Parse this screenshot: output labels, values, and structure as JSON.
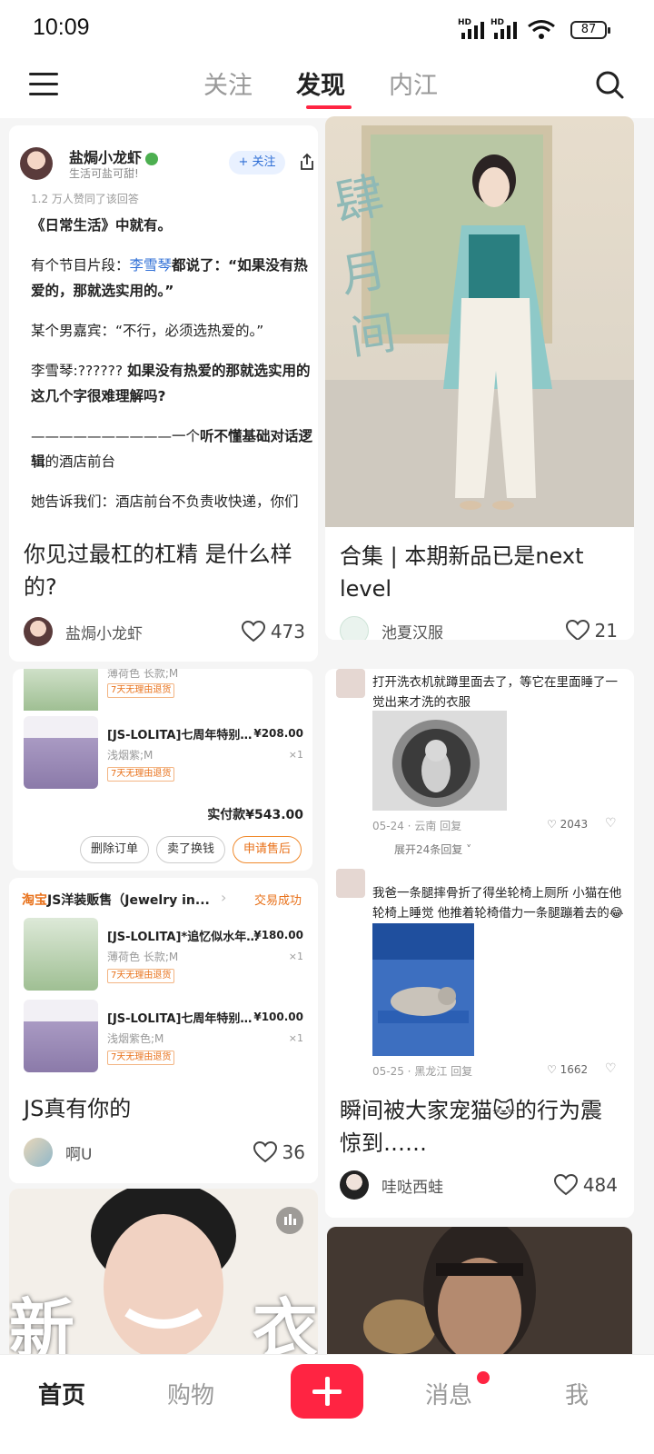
{
  "status_bar": {
    "time": "10:09",
    "hd1": "HD",
    "hd2": "HD",
    "battery": "87"
  },
  "top_nav": {
    "tabs": [
      "关注",
      "发现",
      "内江"
    ],
    "active_tab": "发现"
  },
  "feed": {
    "card1": {
      "answerer": "盐焗小龙虾",
      "tagline": "生活可盐可甜!",
      "follow_label": "+ 关注",
      "agree_count": "1.2 万人赞同了该回答",
      "body": {
        "p1": "《日常生活》中就有。",
        "p2_a": "有个节目片段：",
        "p2_link": "李雪琴",
        "p2_b": "都说了：“如果没有热爱的，那就选实用的。”",
        "p3": "某个男嘉宾：“不行，必须选热爱的。”",
        "p4_a": "李雪琴:?????? ",
        "p4_b": "如果没有热爱的那就选实用的这几个字很难理解吗?",
        "p5_a": "——————————一个",
        "p5_b": "听不懂基础对话逻辑",
        "p5_c": "的酒店前台",
        "p6": "她告诉我们：酒店前台不负责收快递，你们"
      },
      "title": "你见过最杠的杠精 是什么样的?",
      "author": "盐焗小龙虾",
      "likes": "473"
    },
    "card2": {
      "title": "合集 | 本期新品已是next level",
      "author": "池夏汉服",
      "likes": "21"
    },
    "card3": {
      "item_top": {
        "name": "薄荷色 长款;M",
        "tag": "7天无理由退货"
      },
      "item1": {
        "name": "[JS-LOLITA]七周年特别款 ...",
        "price": "¥208.00",
        "spec": "浅烟紫;M",
        "qty": "×1",
        "tag": "7天无理由退货"
      },
      "total": "实付款¥543.00",
      "buttons": [
        "删除订单",
        "卖了换钱",
        "申请售后"
      ]
    },
    "card4": {
      "shop_prefix": "淘宝",
      "shop": "JS洋装贩售（Jewelry in...",
      "status": "交易成功",
      "items": [
        {
          "name": "[JS-LOLITA]*追忆似水年华*...",
          "price": "¥180.00",
          "spec": "薄荷色 长款;M",
          "qty": "×1",
          "tag": "7天无理由退货"
        },
        {
          "name": "[JS-LOLITA]七周年特别款 ...",
          "price": "¥100.00",
          "spec": "浅烟紫色;M",
          "qty": "×1",
          "tag": "7天无理由退货"
        }
      ],
      "title": "JS真有你的",
      "author": "啊U",
      "likes": "36"
    },
    "card5": {
      "comment1": "打开洗衣机就蹲里面去了，等它在里面睡了一觉出来才洗的衣服",
      "meta1": "05-24 · 云南    回复",
      "likes1": "2043",
      "expand": "展开24条回复",
      "comment2": "我爸一条腿摔骨折了得坐轮椅上厕所 小猫在他轮椅上睡觉 他推着轮椅借力一条腿蹦着去的😂",
      "meta2": "05-25 · 黑龙江    回复",
      "likes2": "1662",
      "title": "瞬间被大家宠猫🐱的行为震惊到……",
      "author": "哇哒西蛙",
      "likes": "484"
    },
    "card6": {
      "overlay_left": "新",
      "overlay_right": "衣"
    }
  },
  "bottom_nav": {
    "items": [
      "首页",
      "购物",
      "消息",
      "我"
    ],
    "active": "首页"
  },
  "colors": {
    "accent": "#ff2442",
    "link": "#2f6fd6"
  }
}
